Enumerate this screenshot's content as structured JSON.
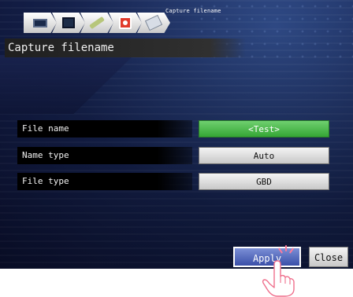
{
  "steps": {
    "items": [
      {
        "icon": "monitor-icon"
      },
      {
        "icon": "display-icon"
      },
      {
        "icon": "pencil-icon"
      },
      {
        "icon": "record-icon"
      },
      {
        "icon": "tag-icon"
      }
    ],
    "current_label": "Capture filename"
  },
  "page": {
    "title": "Capture filename"
  },
  "fields": [
    {
      "label": "File name",
      "value": "<Test>",
      "highlight": true
    },
    {
      "label": "Name type",
      "value": "Auto",
      "highlight": false
    },
    {
      "label": "File type",
      "value": "GBD",
      "highlight": false
    }
  ],
  "buttons": {
    "apply": "Apply",
    "close": "Close"
  },
  "colors": {
    "highlight": "#44b244",
    "apply": "#4a5fb8",
    "background": "#16224c"
  }
}
